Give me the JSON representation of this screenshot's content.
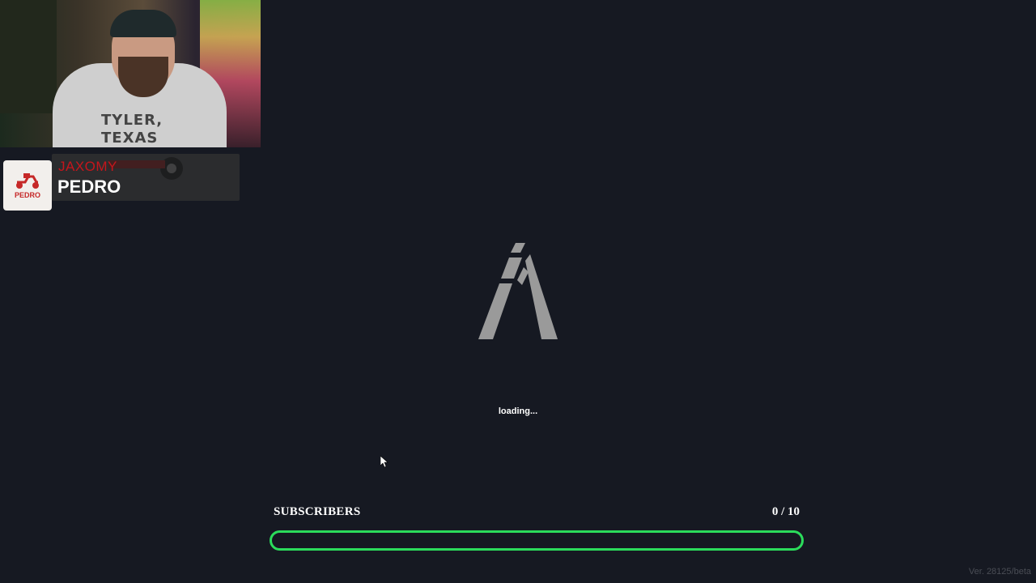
{
  "overlay": {
    "channel_name": "JAXOMY",
    "streamer_name": "PEDRO",
    "avatar_brand": "PEDRO",
    "shirt_text": "TYLER, TEXAS"
  },
  "loader": {
    "logo_icon": "fivem-logo-icon",
    "status_text": "loading..."
  },
  "goal": {
    "label": "SUBSCRIBERS",
    "count_text": "0 / 10",
    "current": 0,
    "target": 10,
    "progress_fraction": 0.0,
    "accent": "#2bdc5b"
  },
  "footer": {
    "version_text": "Ver. 28125/beta"
  },
  "colors": {
    "background": "#161922",
    "logo_fill": "#9a9a9a",
    "channel_name": "#c5161c"
  }
}
